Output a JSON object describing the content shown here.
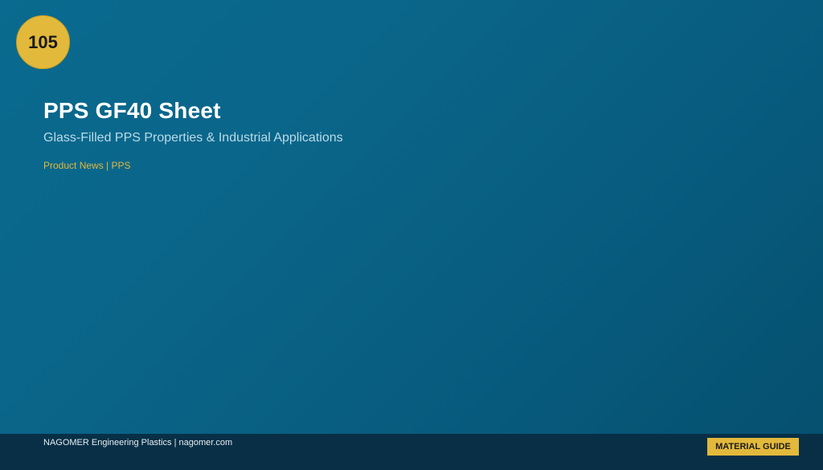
{
  "badge": {
    "number": "105"
  },
  "title": "PPS GF40 Sheet",
  "subtitle": "Glass-Filled PPS Properties & Industrial Applications",
  "tagline": "Product News | PPS",
  "footer": {
    "text": "NAGOMER Engineering Plastics | nagomer.com",
    "button_label": "MATERIAL GUIDE"
  },
  "colors": {
    "background": "#0a6589",
    "accent": "#e2b93b",
    "footer": "#082f46"
  }
}
